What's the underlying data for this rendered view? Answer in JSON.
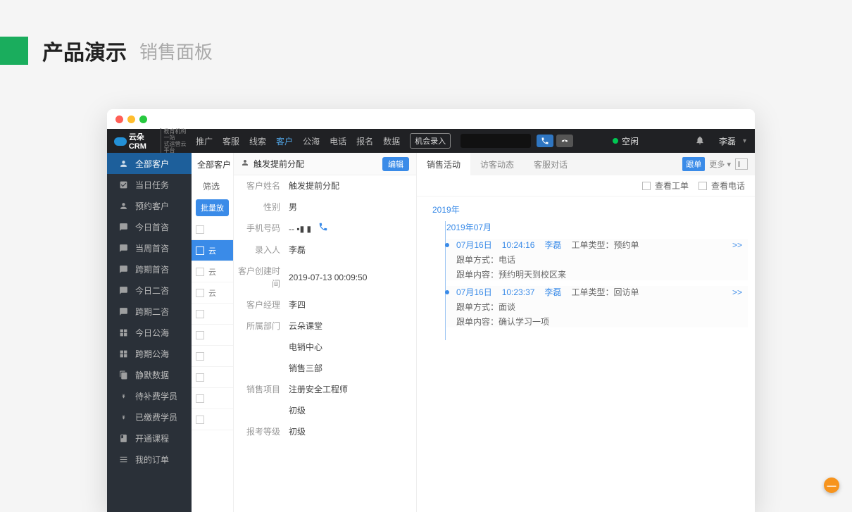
{
  "page": {
    "title": "产品演示",
    "subtitle": "销售面板"
  },
  "brand": {
    "name": "云朵CRM",
    "tagline1": "教育机构一站",
    "tagline2": "式运营云平台"
  },
  "nav": {
    "items": [
      "推广",
      "客服",
      "线索",
      "客户",
      "公海",
      "电话",
      "报名",
      "数据"
    ],
    "activeIndex": 3,
    "opportunity": "机会录入"
  },
  "status": {
    "state": "空闲"
  },
  "topbar": {
    "user": "李磊"
  },
  "sidebar": {
    "items": [
      "全部客户",
      "当日任务",
      "预约客户",
      "今日首咨",
      "当周首咨",
      "跨期首咨",
      "今日二咨",
      "跨期二咨",
      "今日公海",
      "跨期公海",
      "静默数据",
      "待补费学员",
      "已缴费学员",
      "开通课程",
      "我的订单"
    ],
    "activeIndex": 0
  },
  "listcol": {
    "title": "全部客户",
    "filter_label": "筛选",
    "batch_btn": "批量放",
    "rows": [
      "",
      "云",
      "云",
      "云",
      "",
      "",
      "",
      "",
      ""
    ],
    "selectedIndex": 1
  },
  "detail": {
    "head": "触发提前分配",
    "edit": "编辑",
    "fields": {
      "name_l": "客户姓名",
      "name_v": "触发提前分配",
      "gender_l": "性别",
      "gender_v": "男",
      "phone_l": "手机号码",
      "phone_v": "-- ▪▮ ▮",
      "entered_l": "录入人",
      "entered_v": "李磊",
      "created_l": "客户创建时间",
      "created_v": "2019-07-13 00:09:50",
      "mgr_l": "客户经理",
      "mgr_v": "李四",
      "dept_l": "所属部门",
      "dept_v1": "云朵课堂",
      "dept_v2": "电销中心",
      "dept_v3": "销售三部",
      "proj_l": "销售项目",
      "proj_v1": "注册安全工程师",
      "proj_v2": "初级",
      "level_l": "报考等级",
      "level_v": "初级"
    }
  },
  "right": {
    "tabs": [
      "销售活动",
      "访客动态",
      "客服对话"
    ],
    "activeTab": 0,
    "tag": "跟单",
    "more": "更多 ▾",
    "toolbar": {
      "ticket": "查看工单",
      "call": "查看电话"
    },
    "year": "2019年",
    "month": "2019年07月",
    "entries": [
      {
        "date": "07月16日",
        "time": "10:24:16",
        "user": "李磊",
        "type_l": "工单类型：",
        "type_v": "预约单",
        "method_l": "跟单方式：",
        "method_v": "电话",
        "content_l": "跟单内容：",
        "content_v": "预约明天到校区来",
        "arrow": ">>"
      },
      {
        "date": "07月16日",
        "time": "10:23:37",
        "user": "李磊",
        "type_l": "工单类型：",
        "type_v": "回访单",
        "method_l": "跟单方式：",
        "method_v": "面谈",
        "content_l": "跟单内容：",
        "content_v": "确认学习一项",
        "arrow": ">>"
      }
    ]
  },
  "float_badge": "—"
}
